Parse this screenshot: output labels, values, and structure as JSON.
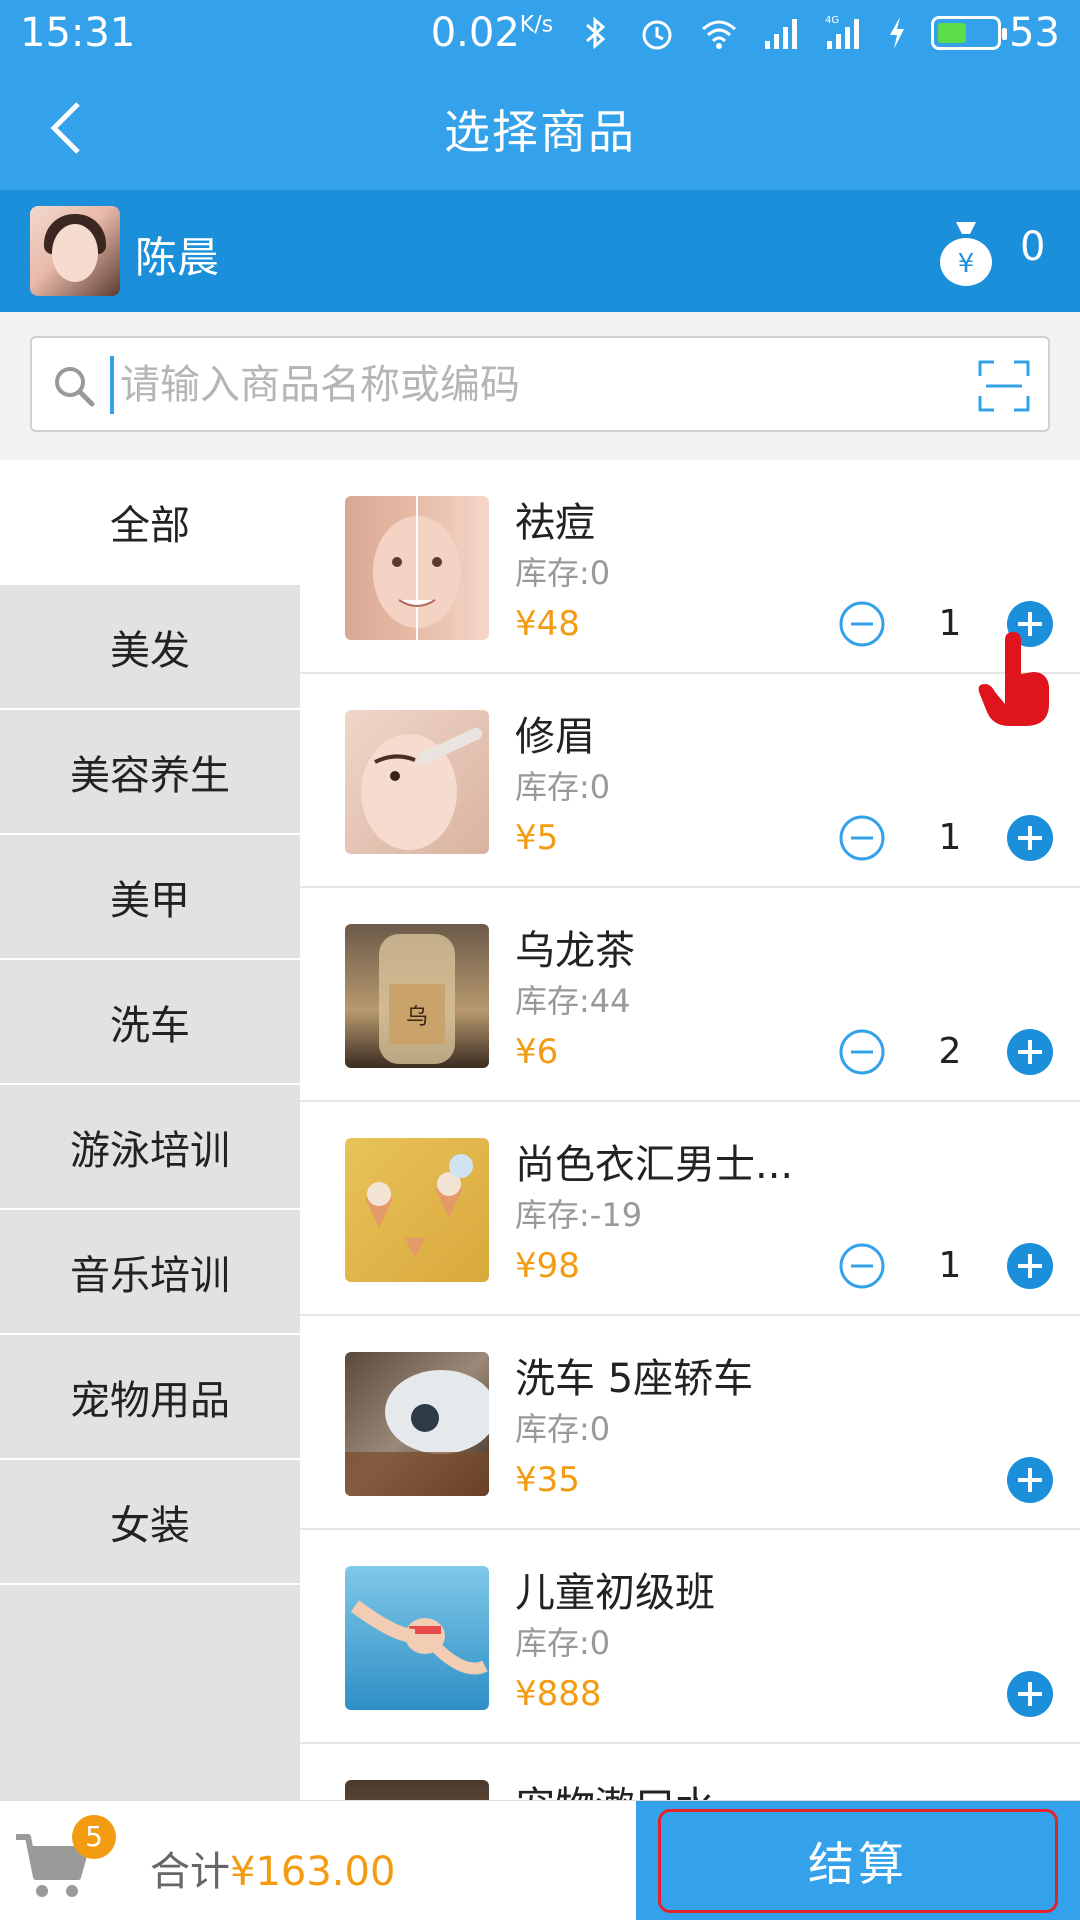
{
  "status_bar": {
    "time": "15:31",
    "speed": "0.02",
    "speed_unit": "K/s",
    "battery": "53",
    "battery_level": 0.53
  },
  "app_bar": {
    "title": "选择商品"
  },
  "user": {
    "name": "陈晨",
    "balance": "0"
  },
  "search": {
    "placeholder": "请输入商品名称或编码"
  },
  "categories": [
    "全部",
    "美发",
    "美容养生",
    "美甲",
    "洗车",
    "游泳培训",
    "音乐培训",
    "宠物用品",
    "女装"
  ],
  "active_category": "全部",
  "products": [
    {
      "name": "祛痘",
      "stock": "库存:0",
      "price": "¥48",
      "qty": "1"
    },
    {
      "name": "修眉",
      "stock": "库存:0",
      "price": "¥5",
      "qty": "1"
    },
    {
      "name": "乌龙茶",
      "stock": "库存:44",
      "price": "¥6",
      "qty": "2"
    },
    {
      "name": "尚色衣汇男士...",
      "stock": "库存:-19",
      "price": "¥98",
      "qty": "1"
    },
    {
      "name": "洗车 5座轿车",
      "stock": "库存:0",
      "price": "¥35",
      "qty": ""
    },
    {
      "name": "儿童初级班",
      "stock": "库存:0",
      "price": "¥888",
      "qty": ""
    },
    {
      "name": "宠物漱口水",
      "stock": "",
      "price": "",
      "qty": ""
    }
  ],
  "cart": {
    "count": "5",
    "total_label": "合计",
    "total_value": "¥163.00",
    "checkout_label": "结算"
  },
  "colors": {
    "primary": "#33a2ea",
    "user_bar": "#1b8fd9",
    "price": "#f39c12",
    "highlight": "#e2242a"
  }
}
